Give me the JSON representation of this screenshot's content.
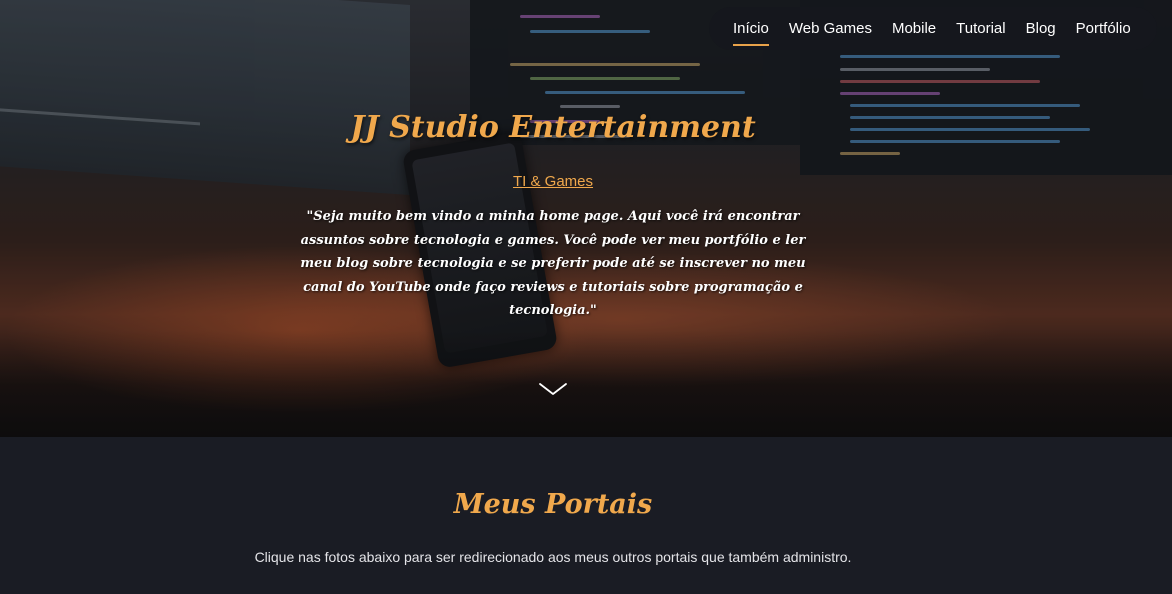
{
  "nav": {
    "items": [
      {
        "label": "Início",
        "active": true
      },
      {
        "label": "Web Games",
        "active": false
      },
      {
        "label": "Mobile",
        "active": false
      },
      {
        "label": "Tutorial",
        "active": false
      },
      {
        "label": "Blog",
        "active": false
      },
      {
        "label": "Portfólio",
        "active": false
      }
    ]
  },
  "hero": {
    "title": "JJ Studio Entertainment",
    "subtitle": "TI & Games",
    "text": "\"Seja muito bem vindo a minha home page. Aqui você irá encontrar assuntos sobre tecnologia e games. Você pode ver meu portfólio e ler meu blog sobre tecnologia e se preferir pode até se inscrever no meu canal do YouTube onde faço reviews e tutoriais sobre programação e tecnologia.\"",
    "scroll_icon": "chevron-down-icon"
  },
  "portals": {
    "title": "Meus Portais",
    "text": "Clique nas fotos abaixo para ser redirecionado aos meus outros portais que também administro."
  },
  "colors": {
    "accent": "#f0a84c",
    "nav_bg": "#15171d",
    "section_bg": "#1a1c24"
  }
}
